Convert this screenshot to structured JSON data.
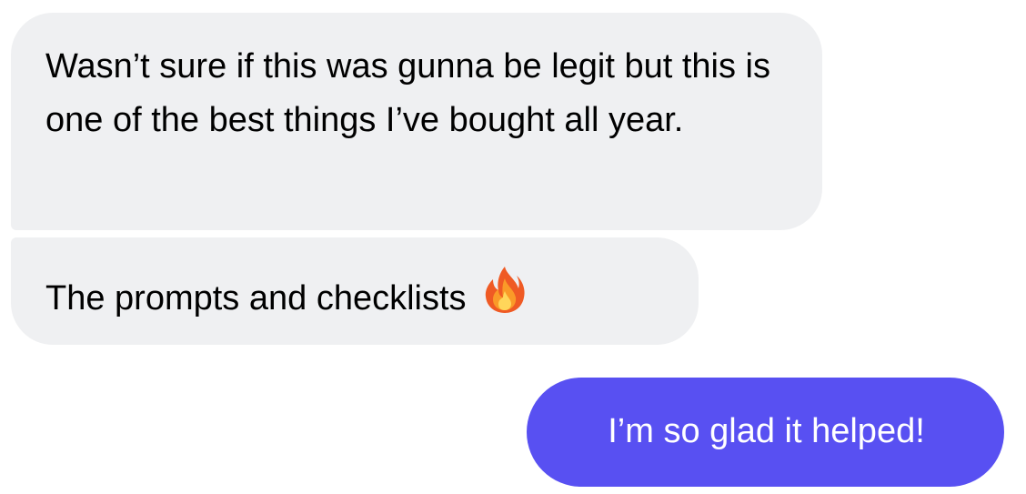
{
  "conversation": {
    "incoming": [
      {
        "text": "Wasn’t sure if this was gunna be legit but this is one of the best things I’ve bought all year."
      },
      {
        "text": "The prompts and checklists",
        "emoji": "fire-icon"
      }
    ],
    "outgoing": [
      {
        "text": "I’m so glad it helped!"
      }
    ]
  },
  "colors": {
    "incoming_bubble": "#eff0f2",
    "outgoing_bubble": "#5850f2",
    "outgoing_text": "#ffffff",
    "incoming_text": "#000000"
  }
}
